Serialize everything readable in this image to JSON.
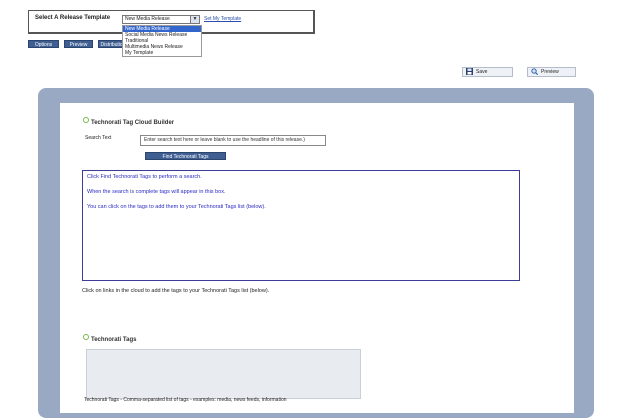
{
  "template_selector": {
    "label": "Select A Release Template",
    "selected": "New Media Release",
    "link": "Set My Template",
    "options": [
      {
        "label": "New Media Release",
        "selected": true
      },
      {
        "label": "Social Media News Release",
        "selected": false
      },
      {
        "label": "Traditional",
        "selected": false
      },
      {
        "label": "Multimedia News Release",
        "selected": false
      },
      {
        "label": "My Template",
        "selected": false
      }
    ]
  },
  "tabs": [
    "Options",
    "Preview",
    "Distribution"
  ],
  "toolbar": {
    "save": "Save",
    "preview": "Preview"
  },
  "cloud_builder": {
    "title": "Technorati Tag Cloud Builder",
    "search_label": "Search Text",
    "search_value": "Enter search text here or leave blank to use the headline of this release.)",
    "find_button": "Find Technorati Tags",
    "messages": [
      "Click Find Technorati Tags to perform a search.",
      "When the search is complete tags will appear in this box.",
      "You can click on the tags to add them to your Technorati Tags list (below)."
    ],
    "note": "Click on links in the cloud to add the tags to your Technorati Tags list (below)."
  },
  "technorati_tags": {
    "title": "Technorati Tags",
    "note": "Technorati Tags - Comma-separated list of tags - examples: media, news feeds, information"
  },
  "colors": {
    "frame": "#9aa9c3",
    "button": "#3f5f93",
    "cloud_border": "#3d3d98",
    "cloud_text": "#2b2bc2",
    "leaf_icon": "#7ab648"
  }
}
